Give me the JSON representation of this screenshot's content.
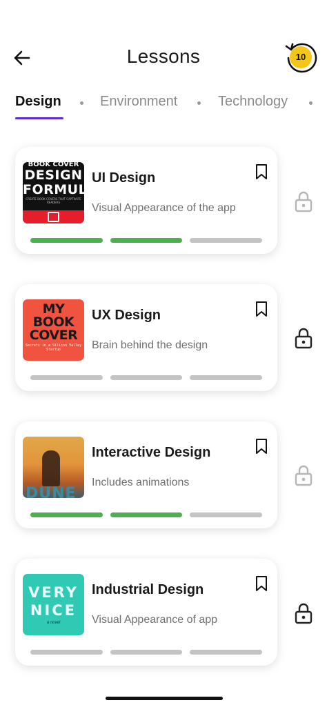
{
  "header": {
    "title": "Lessons",
    "streak_count": "10"
  },
  "tabs": [
    {
      "label": "Design",
      "active": true
    },
    {
      "label": "Environment",
      "active": false
    },
    {
      "label": "Technology",
      "active": false
    }
  ],
  "lessons": [
    {
      "title": "UI Design",
      "subtitle": "Visual Appearance of the app",
      "progress_completed": 2,
      "progress_total": 3,
      "locked": true,
      "cover": {
        "line1": "BOOK COVER",
        "line2": "DESIGN",
        "line3": "FORMULA",
        "line4": "CREATE BOOK COVERS THAT CAPTIVATE READERS"
      }
    },
    {
      "title": "UX Design",
      "subtitle": "Brain behind the design",
      "progress_completed": 0,
      "progress_total": 3,
      "locked": true,
      "cover": {
        "line1": "MY",
        "line2": "BOOK",
        "line3": "COVER",
        "line4": "Secrets in a Silicon Valley Startup"
      }
    },
    {
      "title": "Interactive Design",
      "subtitle": "Includes animations",
      "progress_completed": 2,
      "progress_total": 3,
      "locked": true,
      "cover": {
        "word": "DUNE"
      }
    },
    {
      "title": "Industrial Design",
      "subtitle": "Visual Appearance of app",
      "progress_completed": 0,
      "progress_total": 3,
      "locked": true,
      "cover": {
        "line1": "VERY",
        "line2": "NICE",
        "line3": "a novel"
      }
    }
  ],
  "colors": {
    "accent": "#5b2bd6",
    "progress_done": "#4caf50",
    "progress_todo": "#c4c4c4",
    "streak_badge": "#f5c518"
  },
  "icons": {
    "back": "arrow-left-icon",
    "streak": "history-badge-icon",
    "bookmark": "bookmark-icon",
    "lock": "lock-icon"
  }
}
